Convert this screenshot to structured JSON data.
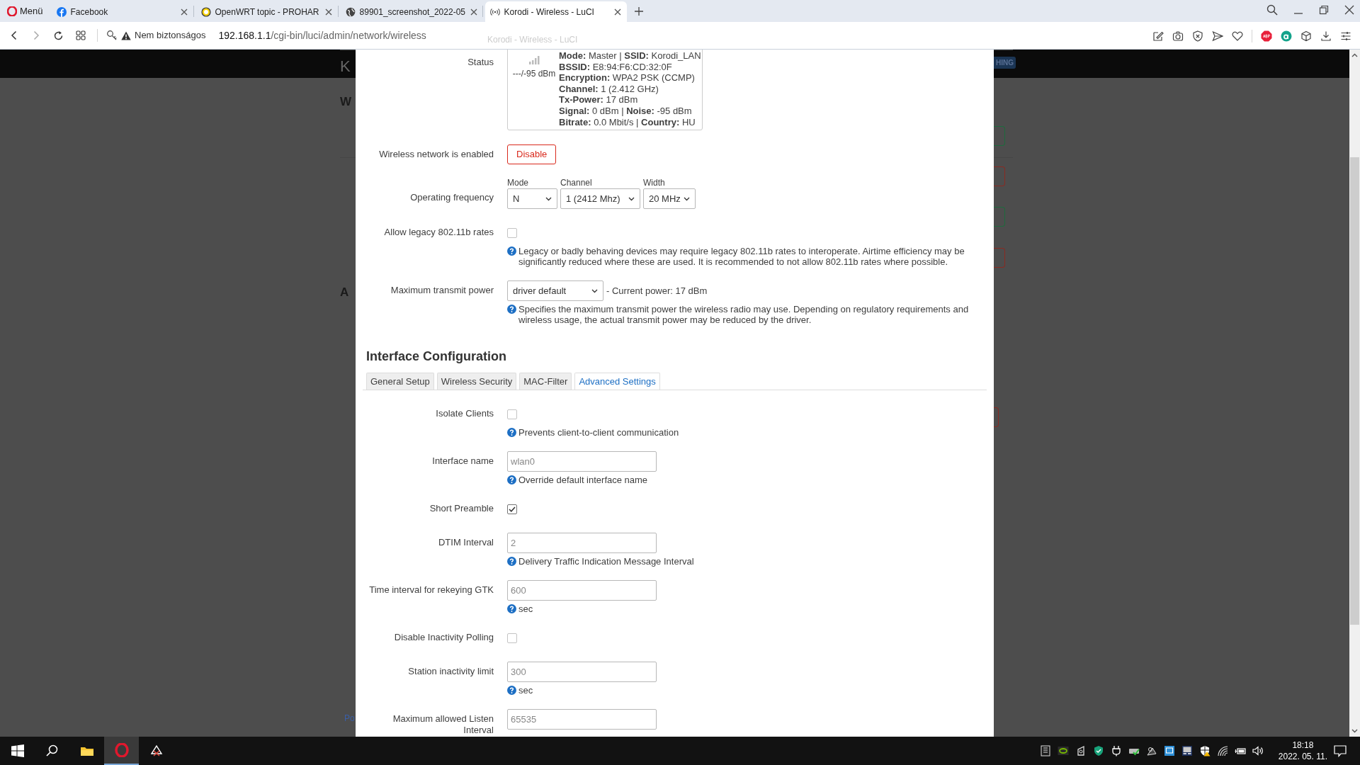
{
  "browser": {
    "menu_button": "Menü",
    "tabs": [
      {
        "title": "Facebook",
        "selected": false
      },
      {
        "title": "OpenWRT topic - PROHAR",
        "selected": false
      },
      {
        "title": "89901_screenshot_2022-05",
        "selected": false
      },
      {
        "title": "Korodi - Wireless - LuCI",
        "selected": true
      }
    ],
    "tooltip": "Korodi - Wireless - LuCI",
    "address": {
      "security": "Nem biztonságos",
      "host": "192.168.1.1",
      "path": "/cgi-bin/luci/admin/network/wireless"
    }
  },
  "background": {
    "header_letter": "K",
    "badge": "HING",
    "heading_1": "W",
    "heading_2": "A",
    "footer": "Po",
    "button_edges": [
      {
        "kind": "positive"
      },
      {
        "kind": "negative"
      },
      {
        "kind": "positive"
      },
      {
        "kind": "negative"
      },
      {
        "kind": "negative"
      }
    ]
  },
  "dialog": {
    "status": {
      "label": "Status",
      "signal": "---/-95 dBm",
      "lines": [
        "**Mode:** Master | **SSID:** Korodi_LAN",
        "**BSSID:** E8:94:F6:CD:32:0F",
        "**Encryption:** WPA2 PSK (CCMP)",
        "**Channel:** 1 (2.412 GHz)",
        "**Tx-Power:** 17 dBm",
        "**Signal:** 0 dBm | **Noise:** -95 dBm",
        "**Bitrate:** 0.0 Mbit/s | **Country:** HU"
      ]
    },
    "device_fields": [
      {
        "kind": "button",
        "label": "Wireless network is enabled",
        "button": "Disable"
      },
      {
        "kind": "select_group",
        "label": "Operating frequency",
        "selects": [
          {
            "caption": "Mode",
            "value": "N"
          },
          {
            "caption": "Channel",
            "value": "1 (2412 Mhz)"
          },
          {
            "caption": "Width",
            "value": "20 MHz"
          }
        ]
      },
      {
        "kind": "checkbox",
        "label": "Allow legacy 802.11b rates",
        "checked": false,
        "help": "Legacy or badly behaving devices may require legacy 802.11b rates to interoperate. Airtime efficiency may be significantly reduced where these are used. It is recommended to not allow 802.11b rates where possible."
      },
      {
        "kind": "select",
        "label": "Maximum transmit power",
        "value": "driver default",
        "suffix": "- Current power: 17 dBm",
        "help": "Specifies the maximum transmit power the wireless radio may use. Depending on regulatory requirements and wireless usage, the actual transmit power may be reduced by the driver."
      }
    ],
    "section_title": "Interface Configuration",
    "tabs": [
      {
        "label": "General Setup",
        "selected": false
      },
      {
        "label": "Wireless Security",
        "selected": false
      },
      {
        "label": "MAC-Filter",
        "selected": false
      },
      {
        "label": "Advanced Settings",
        "selected": true
      }
    ],
    "advanced_fields": [
      {
        "kind": "checkbox",
        "label": "Isolate Clients",
        "checked": false,
        "help": "Prevents client-to-client communication"
      },
      {
        "kind": "input",
        "label": "Interface name",
        "placeholder": "wlan0",
        "help": "Override default interface name"
      },
      {
        "kind": "checkbox",
        "label": "Short Preamble",
        "checked": true
      },
      {
        "kind": "input",
        "label": "DTIM Interval",
        "placeholder": "2",
        "help": "Delivery Traffic Indication Message Interval"
      },
      {
        "kind": "input",
        "label": "Time interval for rekeying GTK",
        "placeholder": "600",
        "help": "sec"
      },
      {
        "kind": "checkbox",
        "label": "Disable Inactivity Polling",
        "checked": false
      },
      {
        "kind": "input",
        "label": "Station inactivity limit",
        "placeholder": "300",
        "help": "sec"
      },
      {
        "kind": "input",
        "label": "Maximum allowed Listen Interval",
        "placeholder": "65535"
      }
    ]
  },
  "taskbar": {
    "time": "18:18",
    "date": "2022. 05. 11."
  }
}
